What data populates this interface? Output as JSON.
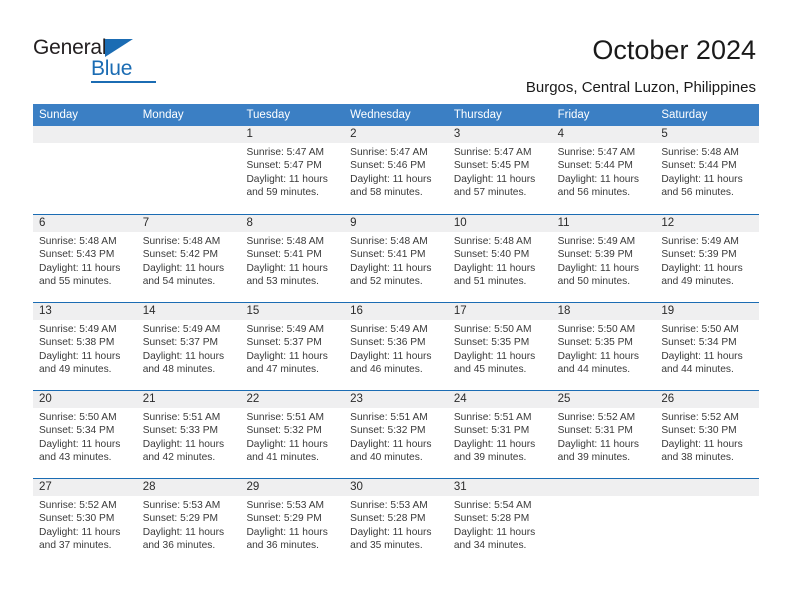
{
  "brand": {
    "name_top": "General",
    "name_bottom": "Blue",
    "accent_color": "#1b6cb3"
  },
  "header": {
    "title": "October 2024",
    "subtitle": "Burgos, Central Luzon, Philippines"
  },
  "calendar": {
    "header_bg": "#3b7fc4",
    "daynum_bg": "#efeff0",
    "divider_color": "#1b6cb3",
    "weekdays": [
      "Sunday",
      "Monday",
      "Tuesday",
      "Wednesday",
      "Thursday",
      "Friday",
      "Saturday"
    ],
    "weeks": [
      [
        {
          "day": "",
          "sunrise": "",
          "sunset": "",
          "daylight": ""
        },
        {
          "day": "",
          "sunrise": "",
          "sunset": "",
          "daylight": ""
        },
        {
          "day": "1",
          "sunrise": "Sunrise: 5:47 AM",
          "sunset": "Sunset: 5:47 PM",
          "daylight": "Daylight: 11 hours and 59 minutes."
        },
        {
          "day": "2",
          "sunrise": "Sunrise: 5:47 AM",
          "sunset": "Sunset: 5:46 PM",
          "daylight": "Daylight: 11 hours and 58 minutes."
        },
        {
          "day": "3",
          "sunrise": "Sunrise: 5:47 AM",
          "sunset": "Sunset: 5:45 PM",
          "daylight": "Daylight: 11 hours and 57 minutes."
        },
        {
          "day": "4",
          "sunrise": "Sunrise: 5:47 AM",
          "sunset": "Sunset: 5:44 PM",
          "daylight": "Daylight: 11 hours and 56 minutes."
        },
        {
          "day": "5",
          "sunrise": "Sunrise: 5:48 AM",
          "sunset": "Sunset: 5:44 PM",
          "daylight": "Daylight: 11 hours and 56 minutes."
        }
      ],
      [
        {
          "day": "6",
          "sunrise": "Sunrise: 5:48 AM",
          "sunset": "Sunset: 5:43 PM",
          "daylight": "Daylight: 11 hours and 55 minutes."
        },
        {
          "day": "7",
          "sunrise": "Sunrise: 5:48 AM",
          "sunset": "Sunset: 5:42 PM",
          "daylight": "Daylight: 11 hours and 54 minutes."
        },
        {
          "day": "8",
          "sunrise": "Sunrise: 5:48 AM",
          "sunset": "Sunset: 5:41 PM",
          "daylight": "Daylight: 11 hours and 53 minutes."
        },
        {
          "day": "9",
          "sunrise": "Sunrise: 5:48 AM",
          "sunset": "Sunset: 5:41 PM",
          "daylight": "Daylight: 11 hours and 52 minutes."
        },
        {
          "day": "10",
          "sunrise": "Sunrise: 5:48 AM",
          "sunset": "Sunset: 5:40 PM",
          "daylight": "Daylight: 11 hours and 51 minutes."
        },
        {
          "day": "11",
          "sunrise": "Sunrise: 5:49 AM",
          "sunset": "Sunset: 5:39 PM",
          "daylight": "Daylight: 11 hours and 50 minutes."
        },
        {
          "day": "12",
          "sunrise": "Sunrise: 5:49 AM",
          "sunset": "Sunset: 5:39 PM",
          "daylight": "Daylight: 11 hours and 49 minutes."
        }
      ],
      [
        {
          "day": "13",
          "sunrise": "Sunrise: 5:49 AM",
          "sunset": "Sunset: 5:38 PM",
          "daylight": "Daylight: 11 hours and 49 minutes."
        },
        {
          "day": "14",
          "sunrise": "Sunrise: 5:49 AM",
          "sunset": "Sunset: 5:37 PM",
          "daylight": "Daylight: 11 hours and 48 minutes."
        },
        {
          "day": "15",
          "sunrise": "Sunrise: 5:49 AM",
          "sunset": "Sunset: 5:37 PM",
          "daylight": "Daylight: 11 hours and 47 minutes."
        },
        {
          "day": "16",
          "sunrise": "Sunrise: 5:49 AM",
          "sunset": "Sunset: 5:36 PM",
          "daylight": "Daylight: 11 hours and 46 minutes."
        },
        {
          "day": "17",
          "sunrise": "Sunrise: 5:50 AM",
          "sunset": "Sunset: 5:35 PM",
          "daylight": "Daylight: 11 hours and 45 minutes."
        },
        {
          "day": "18",
          "sunrise": "Sunrise: 5:50 AM",
          "sunset": "Sunset: 5:35 PM",
          "daylight": "Daylight: 11 hours and 44 minutes."
        },
        {
          "day": "19",
          "sunrise": "Sunrise: 5:50 AM",
          "sunset": "Sunset: 5:34 PM",
          "daylight": "Daylight: 11 hours and 44 minutes."
        }
      ],
      [
        {
          "day": "20",
          "sunrise": "Sunrise: 5:50 AM",
          "sunset": "Sunset: 5:34 PM",
          "daylight": "Daylight: 11 hours and 43 minutes."
        },
        {
          "day": "21",
          "sunrise": "Sunrise: 5:51 AM",
          "sunset": "Sunset: 5:33 PM",
          "daylight": "Daylight: 11 hours and 42 minutes."
        },
        {
          "day": "22",
          "sunrise": "Sunrise: 5:51 AM",
          "sunset": "Sunset: 5:32 PM",
          "daylight": "Daylight: 11 hours and 41 minutes."
        },
        {
          "day": "23",
          "sunrise": "Sunrise: 5:51 AM",
          "sunset": "Sunset: 5:32 PM",
          "daylight": "Daylight: 11 hours and 40 minutes."
        },
        {
          "day": "24",
          "sunrise": "Sunrise: 5:51 AM",
          "sunset": "Sunset: 5:31 PM",
          "daylight": "Daylight: 11 hours and 39 minutes."
        },
        {
          "day": "25",
          "sunrise": "Sunrise: 5:52 AM",
          "sunset": "Sunset: 5:31 PM",
          "daylight": "Daylight: 11 hours and 39 minutes."
        },
        {
          "day": "26",
          "sunrise": "Sunrise: 5:52 AM",
          "sunset": "Sunset: 5:30 PM",
          "daylight": "Daylight: 11 hours and 38 minutes."
        }
      ],
      [
        {
          "day": "27",
          "sunrise": "Sunrise: 5:52 AM",
          "sunset": "Sunset: 5:30 PM",
          "daylight": "Daylight: 11 hours and 37 minutes."
        },
        {
          "day": "28",
          "sunrise": "Sunrise: 5:53 AM",
          "sunset": "Sunset: 5:29 PM",
          "daylight": "Daylight: 11 hours and 36 minutes."
        },
        {
          "day": "29",
          "sunrise": "Sunrise: 5:53 AM",
          "sunset": "Sunset: 5:29 PM",
          "daylight": "Daylight: 11 hours and 36 minutes."
        },
        {
          "day": "30",
          "sunrise": "Sunrise: 5:53 AM",
          "sunset": "Sunset: 5:28 PM",
          "daylight": "Daylight: 11 hours and 35 minutes."
        },
        {
          "day": "31",
          "sunrise": "Sunrise: 5:54 AM",
          "sunset": "Sunset: 5:28 PM",
          "daylight": "Daylight: 11 hours and 34 minutes."
        },
        {
          "day": "",
          "sunrise": "",
          "sunset": "",
          "daylight": ""
        },
        {
          "day": "",
          "sunrise": "",
          "sunset": "",
          "daylight": ""
        }
      ]
    ]
  }
}
